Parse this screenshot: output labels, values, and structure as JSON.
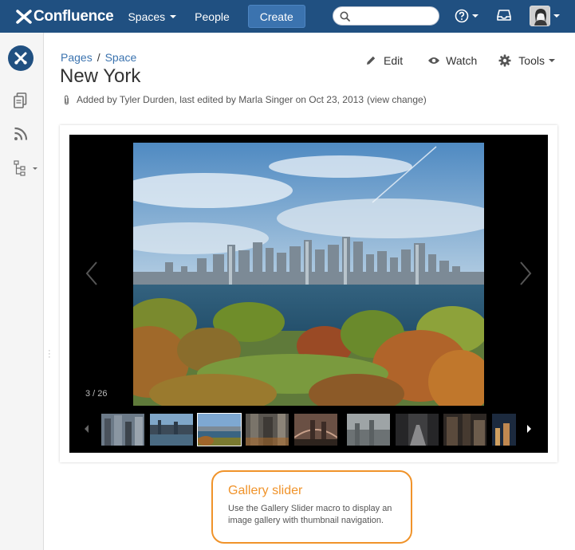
{
  "topbar": {
    "logo_text": "Confluence",
    "nav": [
      {
        "label": "Spaces",
        "has_dropdown": true
      },
      {
        "label": "People",
        "has_dropdown": false
      }
    ],
    "create_label": "Create",
    "search_placeholder": "",
    "colors": {
      "bar": "#205081",
      "create": "#3b73af"
    }
  },
  "sidebar": {
    "icons": [
      "space-logo-icon",
      "pages-icon",
      "blog-feed-icon",
      "page-tree-icon"
    ]
  },
  "page": {
    "breadcrumb": [
      "Pages",
      "Space"
    ],
    "title": "New York",
    "actions": {
      "edit": "Edit",
      "watch": "Watch",
      "tools": "Tools"
    },
    "meta": {
      "text": "Added by Tyler Durden, last edited by Marla Singer on Oct 23, 2013",
      "view_change": "(view change)"
    }
  },
  "gallery": {
    "counter": "3 / 26",
    "current_index": 3,
    "total": 26,
    "thumbnail_count": 9
  },
  "callout": {
    "title": "Gallery slider",
    "body": "Use the Gallery Slider macro to display an image gallery with thumbnail navigation.",
    "accent": "#f0932a"
  }
}
